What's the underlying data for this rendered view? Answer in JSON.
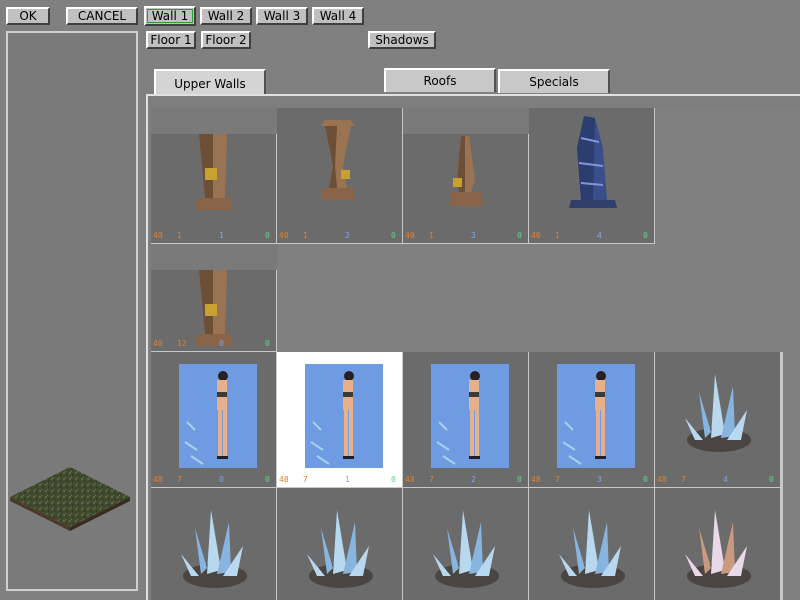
{
  "toolbar": {
    "ok": "OK",
    "cancel": "CANCEL",
    "wall1": "Wall 1",
    "wall2": "Wall 2",
    "wall3": "Wall 3",
    "wall4": "Wall 4",
    "floor1": "Floor 1",
    "floor2": "Floor 2",
    "shadows": "Shadows",
    "active": "Wall 1"
  },
  "tabs": {
    "upper_walls": "Upper Walls",
    "roofs": "Roofs",
    "specials": "Specials",
    "active": "Upper Walls"
  },
  "colors": {
    "background": "#808080",
    "button": "#c0c0c0",
    "cell": "#6b6b6b",
    "selected_cell": "#ffffff",
    "index_orange": "#e08030",
    "index_blue": "#7fa6e8",
    "index_green": "#66d08a",
    "active_outline": "#2e9e2e"
  },
  "tiles": [
    {
      "kind": "pillar-wood",
      "a": "40",
      "b": "1",
      "c": "1",
      "d": "0"
    },
    {
      "kind": "pillar-urn",
      "a": "40",
      "b": "1",
      "c": "2",
      "d": "0"
    },
    {
      "kind": "pillar-small",
      "a": "40",
      "b": "1",
      "c": "3",
      "d": "0"
    },
    {
      "kind": "pillar-blue",
      "a": "40",
      "b": "1",
      "c": "4",
      "d": "0"
    },
    {
      "kind": "pillar-wood",
      "a": "40",
      "b": "12",
      "c": "0",
      "d": "0"
    },
    {
      "kind": "photo",
      "a": "48",
      "b": "7",
      "c": "0",
      "d": "0"
    },
    {
      "kind": "photo",
      "a": "48",
      "b": "7",
      "c": "1",
      "d": "0",
      "selected": true
    },
    {
      "kind": "photo",
      "a": "48",
      "b": "7",
      "c": "2",
      "d": "0"
    },
    {
      "kind": "photo",
      "a": "48",
      "b": "7",
      "c": "3",
      "d": "0"
    },
    {
      "kind": "crystal",
      "a": "48",
      "b": "7",
      "c": "4",
      "d": "0"
    },
    {
      "kind": "crystal"
    },
    {
      "kind": "crystal"
    },
    {
      "kind": "crystal"
    },
    {
      "kind": "crystal"
    },
    {
      "kind": "crystal-warm"
    }
  ]
}
